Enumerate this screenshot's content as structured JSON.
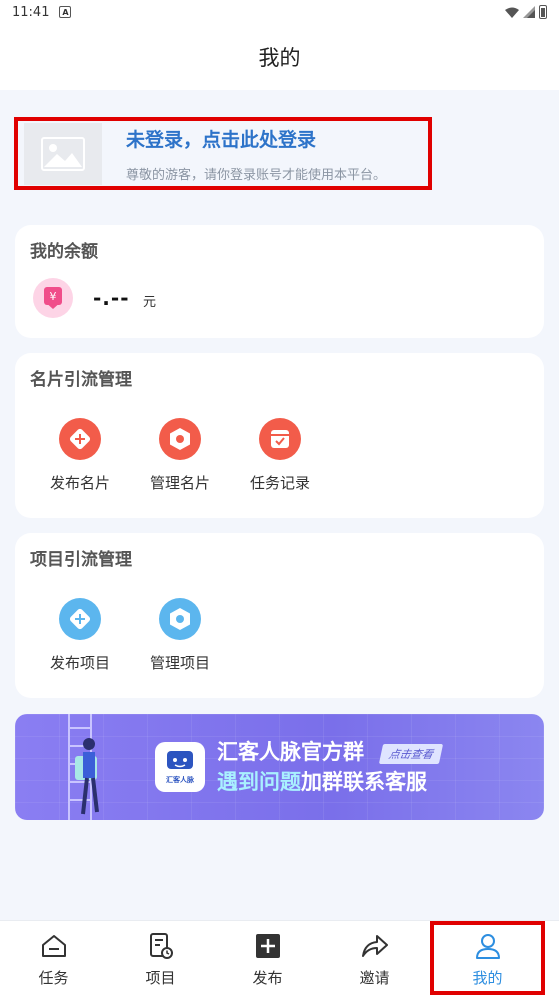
{
  "status_bar": {
    "time": "11:41",
    "notif_glyph": "A"
  },
  "header": {
    "title": "我的"
  },
  "login": {
    "title": "未登录，点击此处登录",
    "subtitle": "尊敬的游客，请你登录账号才能使用本平台。",
    "avatar_icon": "image-placeholder-icon"
  },
  "balance": {
    "title": "我的余额",
    "icon_glyph": "¥",
    "amount": "-.--",
    "unit": "元"
  },
  "card_section": {
    "title": "名片引流管理",
    "items": [
      {
        "label": "发布名片",
        "icon": "add-card-icon"
      },
      {
        "label": "管理名片",
        "icon": "manage-card-icon"
      },
      {
        "label": "任务记录",
        "icon": "task-record-icon"
      }
    ]
  },
  "project_section": {
    "title": "项目引流管理",
    "items": [
      {
        "label": "发布项目",
        "icon": "add-project-icon"
      },
      {
        "label": "管理项目",
        "icon": "manage-project-icon"
      }
    ]
  },
  "banner": {
    "line1": "汇客人脉官方群",
    "button": "点击查看",
    "line2_highlight": "遇到问题",
    "line2_rest": "加群联系客服",
    "logo_text": "汇客人脉"
  },
  "tabbar": {
    "items": [
      {
        "label": "任务",
        "icon": "home-icon"
      },
      {
        "label": "项目",
        "icon": "project-doc-icon"
      },
      {
        "label": "发布",
        "icon": "plus-square-icon"
      },
      {
        "label": "邀请",
        "icon": "share-icon"
      },
      {
        "label": "我的",
        "icon": "user-icon"
      }
    ],
    "active_index": 4
  },
  "colors": {
    "accent_blue": "#2d73c9",
    "active_tab": "#2d8ee0",
    "highlight_border": "#e00000",
    "red_icon": "#f25c4a",
    "blue_icon": "#5cb6ee"
  }
}
